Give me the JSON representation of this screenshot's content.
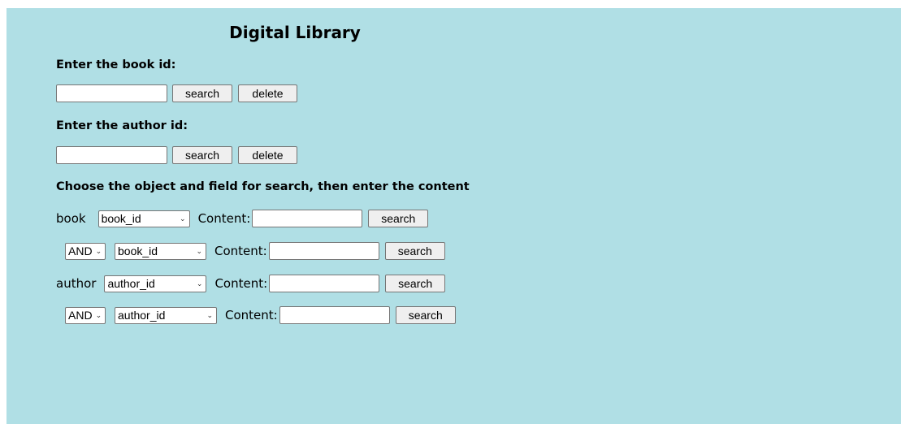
{
  "page": {
    "title": "Digital Library"
  },
  "book_id_section": {
    "label": "Enter the book id:",
    "input_value": "",
    "search_label": "search",
    "delete_label": "delete"
  },
  "author_id_section": {
    "label": "Enter the author id:",
    "input_value": "",
    "search_label": "search",
    "delete_label": "delete"
  },
  "advanced_search": {
    "instruction": "Choose the object and field for search, then enter the content",
    "content_label": "Content:",
    "search_label": "search",
    "rows": [
      {
        "prefix": "book",
        "field": "book_id",
        "content_value": ""
      },
      {
        "prefix": "AND",
        "field": "book_id",
        "content_value": ""
      },
      {
        "prefix": "author",
        "field": "author_id",
        "content_value": ""
      },
      {
        "prefix": "AND",
        "field": "author_id",
        "content_value": ""
      }
    ]
  },
  "colors": {
    "background": "#b0dfe5",
    "button": "#efefef"
  },
  "icons": {
    "dropdown": "chevron-down-icon"
  }
}
